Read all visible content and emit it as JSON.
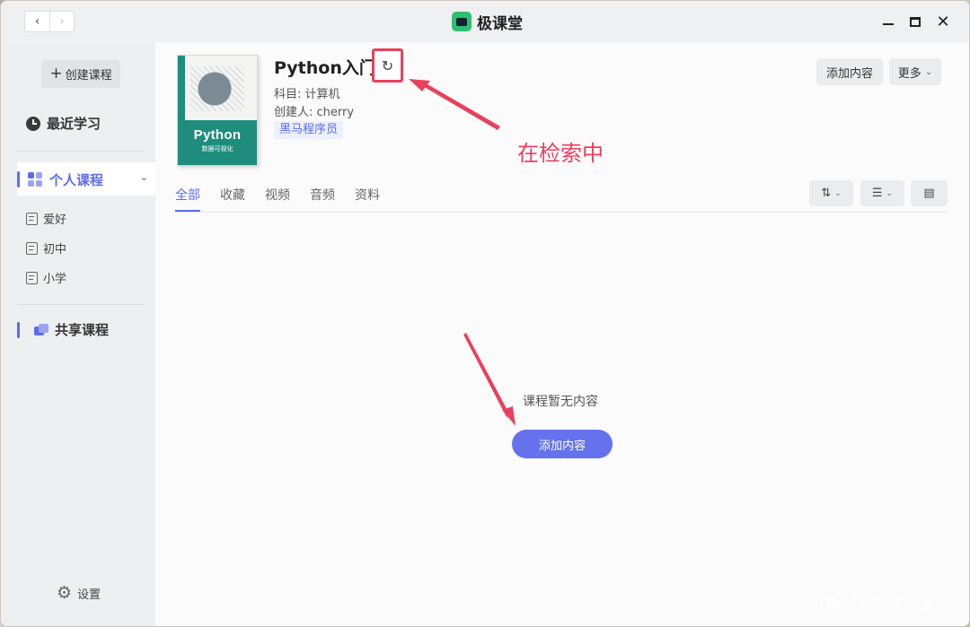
{
  "app": {
    "title": "极课堂"
  },
  "titlebar": {
    "back": "‹",
    "forward": "›",
    "minimize": "",
    "maximize": "",
    "close": "✕"
  },
  "sidebar": {
    "create_label": "创建课程",
    "recent_label": "最近学习",
    "personal_label": "个人课程",
    "personal_items": [
      {
        "label": "爱好"
      },
      {
        "label": "初中"
      },
      {
        "label": "小学"
      }
    ],
    "shared_label": "共享课程",
    "settings_label": "设置"
  },
  "course": {
    "title": "Python入门",
    "subject": "科目: 计算机",
    "creator": "创建人:  cherry",
    "tag": "黑马程序员",
    "cover_title": "Python",
    "cover_subtitle": "数据可视化"
  },
  "toolbar": {
    "add_content": "添加内容",
    "more": "更多"
  },
  "annotation": {
    "text": "在检索中",
    "color": "#e8415c"
  },
  "tabs": [
    {
      "label": "全部",
      "active": true
    },
    {
      "label": "收藏"
    },
    {
      "label": "视频"
    },
    {
      "label": "音频"
    },
    {
      "label": "资料"
    }
  ],
  "empty": {
    "message": "课程暂无内容",
    "add_button": "添加内容"
  },
  "watermark": {
    "icon_text": "值",
    "text": "什么值得买"
  },
  "colors": {
    "accent": "#5b6cf0",
    "button": "#6572ec",
    "highlight": "#e8415c",
    "cover": "#1f8d7e"
  }
}
